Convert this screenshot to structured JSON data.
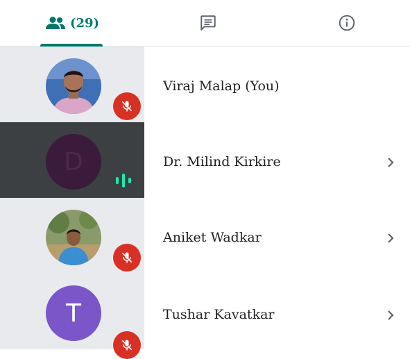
{
  "tabs": {
    "people": {
      "icon": "people-icon",
      "count": "(29)"
    },
    "chat": {
      "icon": "chat-icon"
    },
    "info": {
      "icon": "info-icon"
    }
  },
  "participants": [
    {
      "name": "Viraj Malap (You)",
      "avatar": "photo",
      "status": "muted",
      "has_chevron": false
    },
    {
      "name": "Dr. Milind Kirkire",
      "avatar_letter": "D",
      "status": "speaking",
      "has_chevron": true,
      "highlighted": true
    },
    {
      "name": "Aniket Wadkar",
      "avatar": "photo",
      "status": "muted",
      "has_chevron": true
    },
    {
      "name": "Tushar Kavatkar",
      "avatar_letter": "T",
      "status": "muted",
      "has_chevron": true
    }
  ],
  "colors": {
    "accent": "#00796b",
    "mute_badge": "#d93025",
    "speaking": "#1de9b6",
    "highlight_row": "#3c4043",
    "row_left_bg": "#e8eaed",
    "avatar_purple": "#7b56c8"
  }
}
